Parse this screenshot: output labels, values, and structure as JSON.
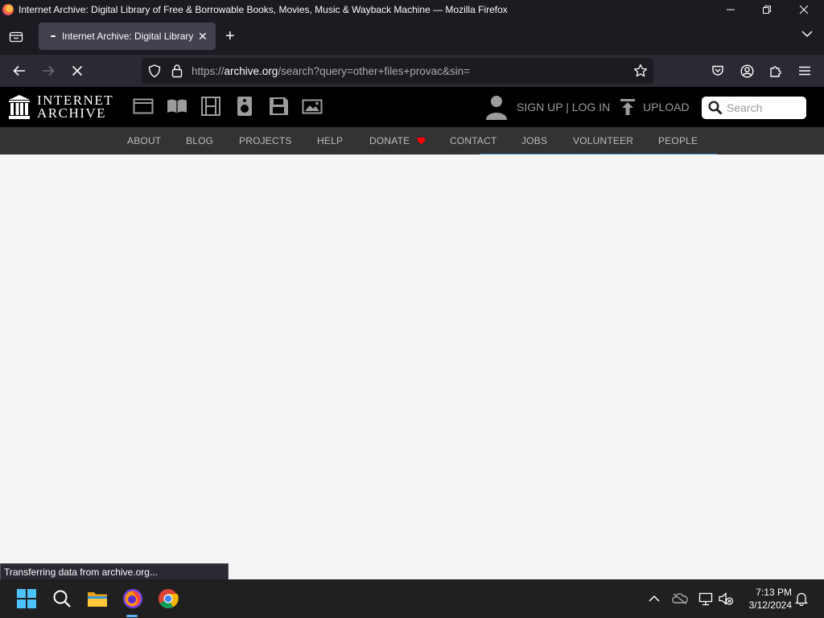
{
  "window": {
    "title": "Internet Archive: Digital Library of Free & Borrowable Books, Movies, Music & Wayback Machine — Mozilla Firefox",
    "minimize_icon": "minimize-icon",
    "restore_icon": "restore-icon",
    "close_icon": "close-icon"
  },
  "tabs": {
    "active_tab_label": "Internet Archive: Digital Library",
    "close_glyph": "✕",
    "new_tab_glyph": "+"
  },
  "navbar": {
    "url_prefix": "https://",
    "url_host": "archive.org",
    "url_path": "/search?query=other+files+provac&sin="
  },
  "ia_header": {
    "logo_line1": "INTERNET",
    "logo_line2": "ARCHIVE",
    "signup_login": "SIGN UP | LOG IN",
    "upload": "UPLOAD",
    "search_placeholder": "Search",
    "media_icons": [
      "web-icon",
      "texts-icon",
      "video-icon",
      "audio-icon",
      "software-icon",
      "images-icon"
    ]
  },
  "ia_subnav": {
    "items": [
      "ABOUT",
      "BLOG",
      "PROJECTS",
      "HELP",
      "DONATE",
      "CONTACT",
      "JOBS",
      "VOLUNTEER",
      "PEOPLE"
    ]
  },
  "status": {
    "text": "Transferring data from archive.org..."
  },
  "taskbar": {
    "time": "7:13 PM",
    "date": "3/12/2024",
    "apps": [
      "windows-start-icon",
      "search-icon",
      "file-explorer-icon",
      "firefox-icon",
      "chrome-icon"
    ]
  },
  "colors": {
    "browser_chrome": "#1c1b22",
    "toolbar": "#2b2a33",
    "ia_black": "#000000",
    "ia_subnav": "#333333",
    "donate_heart": "#ff0100",
    "active_underline": "#428bca"
  }
}
